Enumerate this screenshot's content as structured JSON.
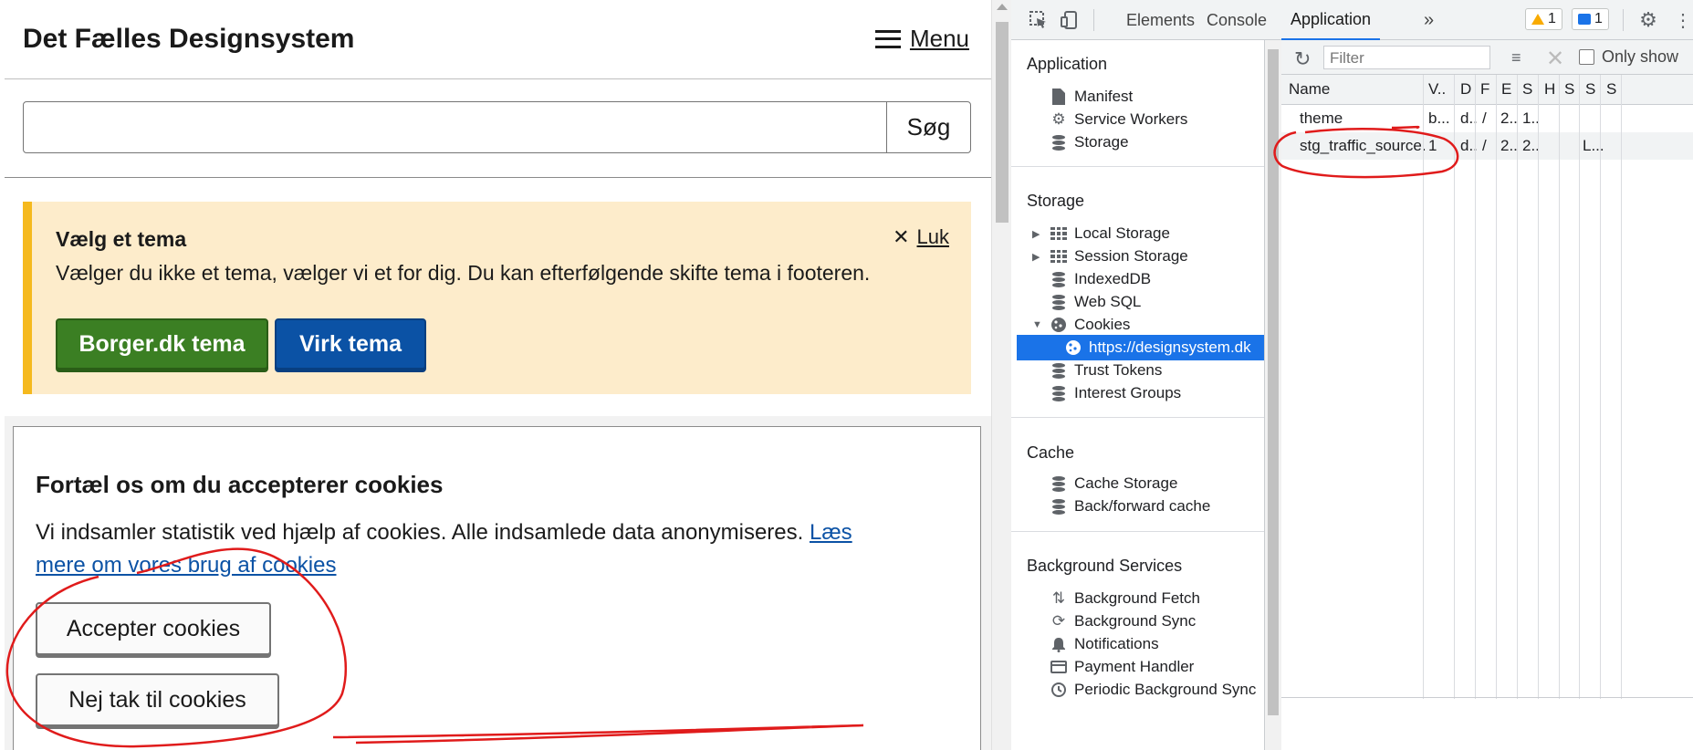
{
  "site": {
    "title": "Det Fælles Designsystem",
    "menu_label": "Menu",
    "search_button": "Søg",
    "search_value": ""
  },
  "theme_alert": {
    "title": "Vælg et tema",
    "text": "Vælger du ikke et tema, vælger vi et for dig. Du kan efterfølgende skifte tema i footeren.",
    "close_label": "Luk",
    "borger_button": "Borger.dk tema",
    "virk_button": "Virk tema"
  },
  "cookie_banner": {
    "title": "Fortæl os om du accepterer cookies",
    "text": "Vi indsamler statistik ved hjælp af cookies. Alle indsamlede data anonymiseres.",
    "link": "Læs mere om vores brug af cookies",
    "accept_button": "Accepter cookies",
    "decline_button": "Nej tak til cookies"
  },
  "devtools": {
    "tabs": [
      "Elements",
      "Console",
      "Application"
    ],
    "active_tab": "Application",
    "warnings_count": "1",
    "messages_count": "1",
    "filter_placeholder": "Filter",
    "only_show_label": "Only show",
    "sidebar": {
      "application_header": "Application",
      "application_items": [
        "Manifest",
        "Service Workers",
        "Storage"
      ],
      "storage_header": "Storage",
      "storage_items": [
        "Local Storage",
        "Session Storage",
        "IndexedDB",
        "Web SQL",
        "Cookies",
        "https://designsystem.dk",
        "Trust Tokens",
        "Interest Groups"
      ],
      "cache_header": "Cache",
      "cache_items": [
        "Cache Storage",
        "Back/forward cache"
      ],
      "background_header": "Background Services",
      "background_items": [
        "Background Fetch",
        "Background Sync",
        "Notifications",
        "Payment Handler",
        "Periodic Background Sync"
      ]
    },
    "cookies_table": {
      "columns": [
        "Name",
        "V..",
        "D",
        "F",
        "E",
        "S",
        "H",
        "S",
        "S",
        "S"
      ],
      "rows": [
        [
          "theme",
          "b...",
          "d..",
          "/",
          "2..",
          "1..",
          "",
          "",
          "",
          ""
        ],
        [
          "stg_traffic_source...",
          "1",
          "d..",
          "/",
          "2..",
          "2..",
          "",
          "",
          "L...",
          ""
        ]
      ]
    }
  },
  "colors": {
    "annotation": "#e01b1b",
    "green_button": "#3b7f23",
    "blue_button": "#0b52a5",
    "alert_bg": "#fdeccb",
    "alert_border": "#f5b91e",
    "devtools_selected": "#1a73e8"
  }
}
